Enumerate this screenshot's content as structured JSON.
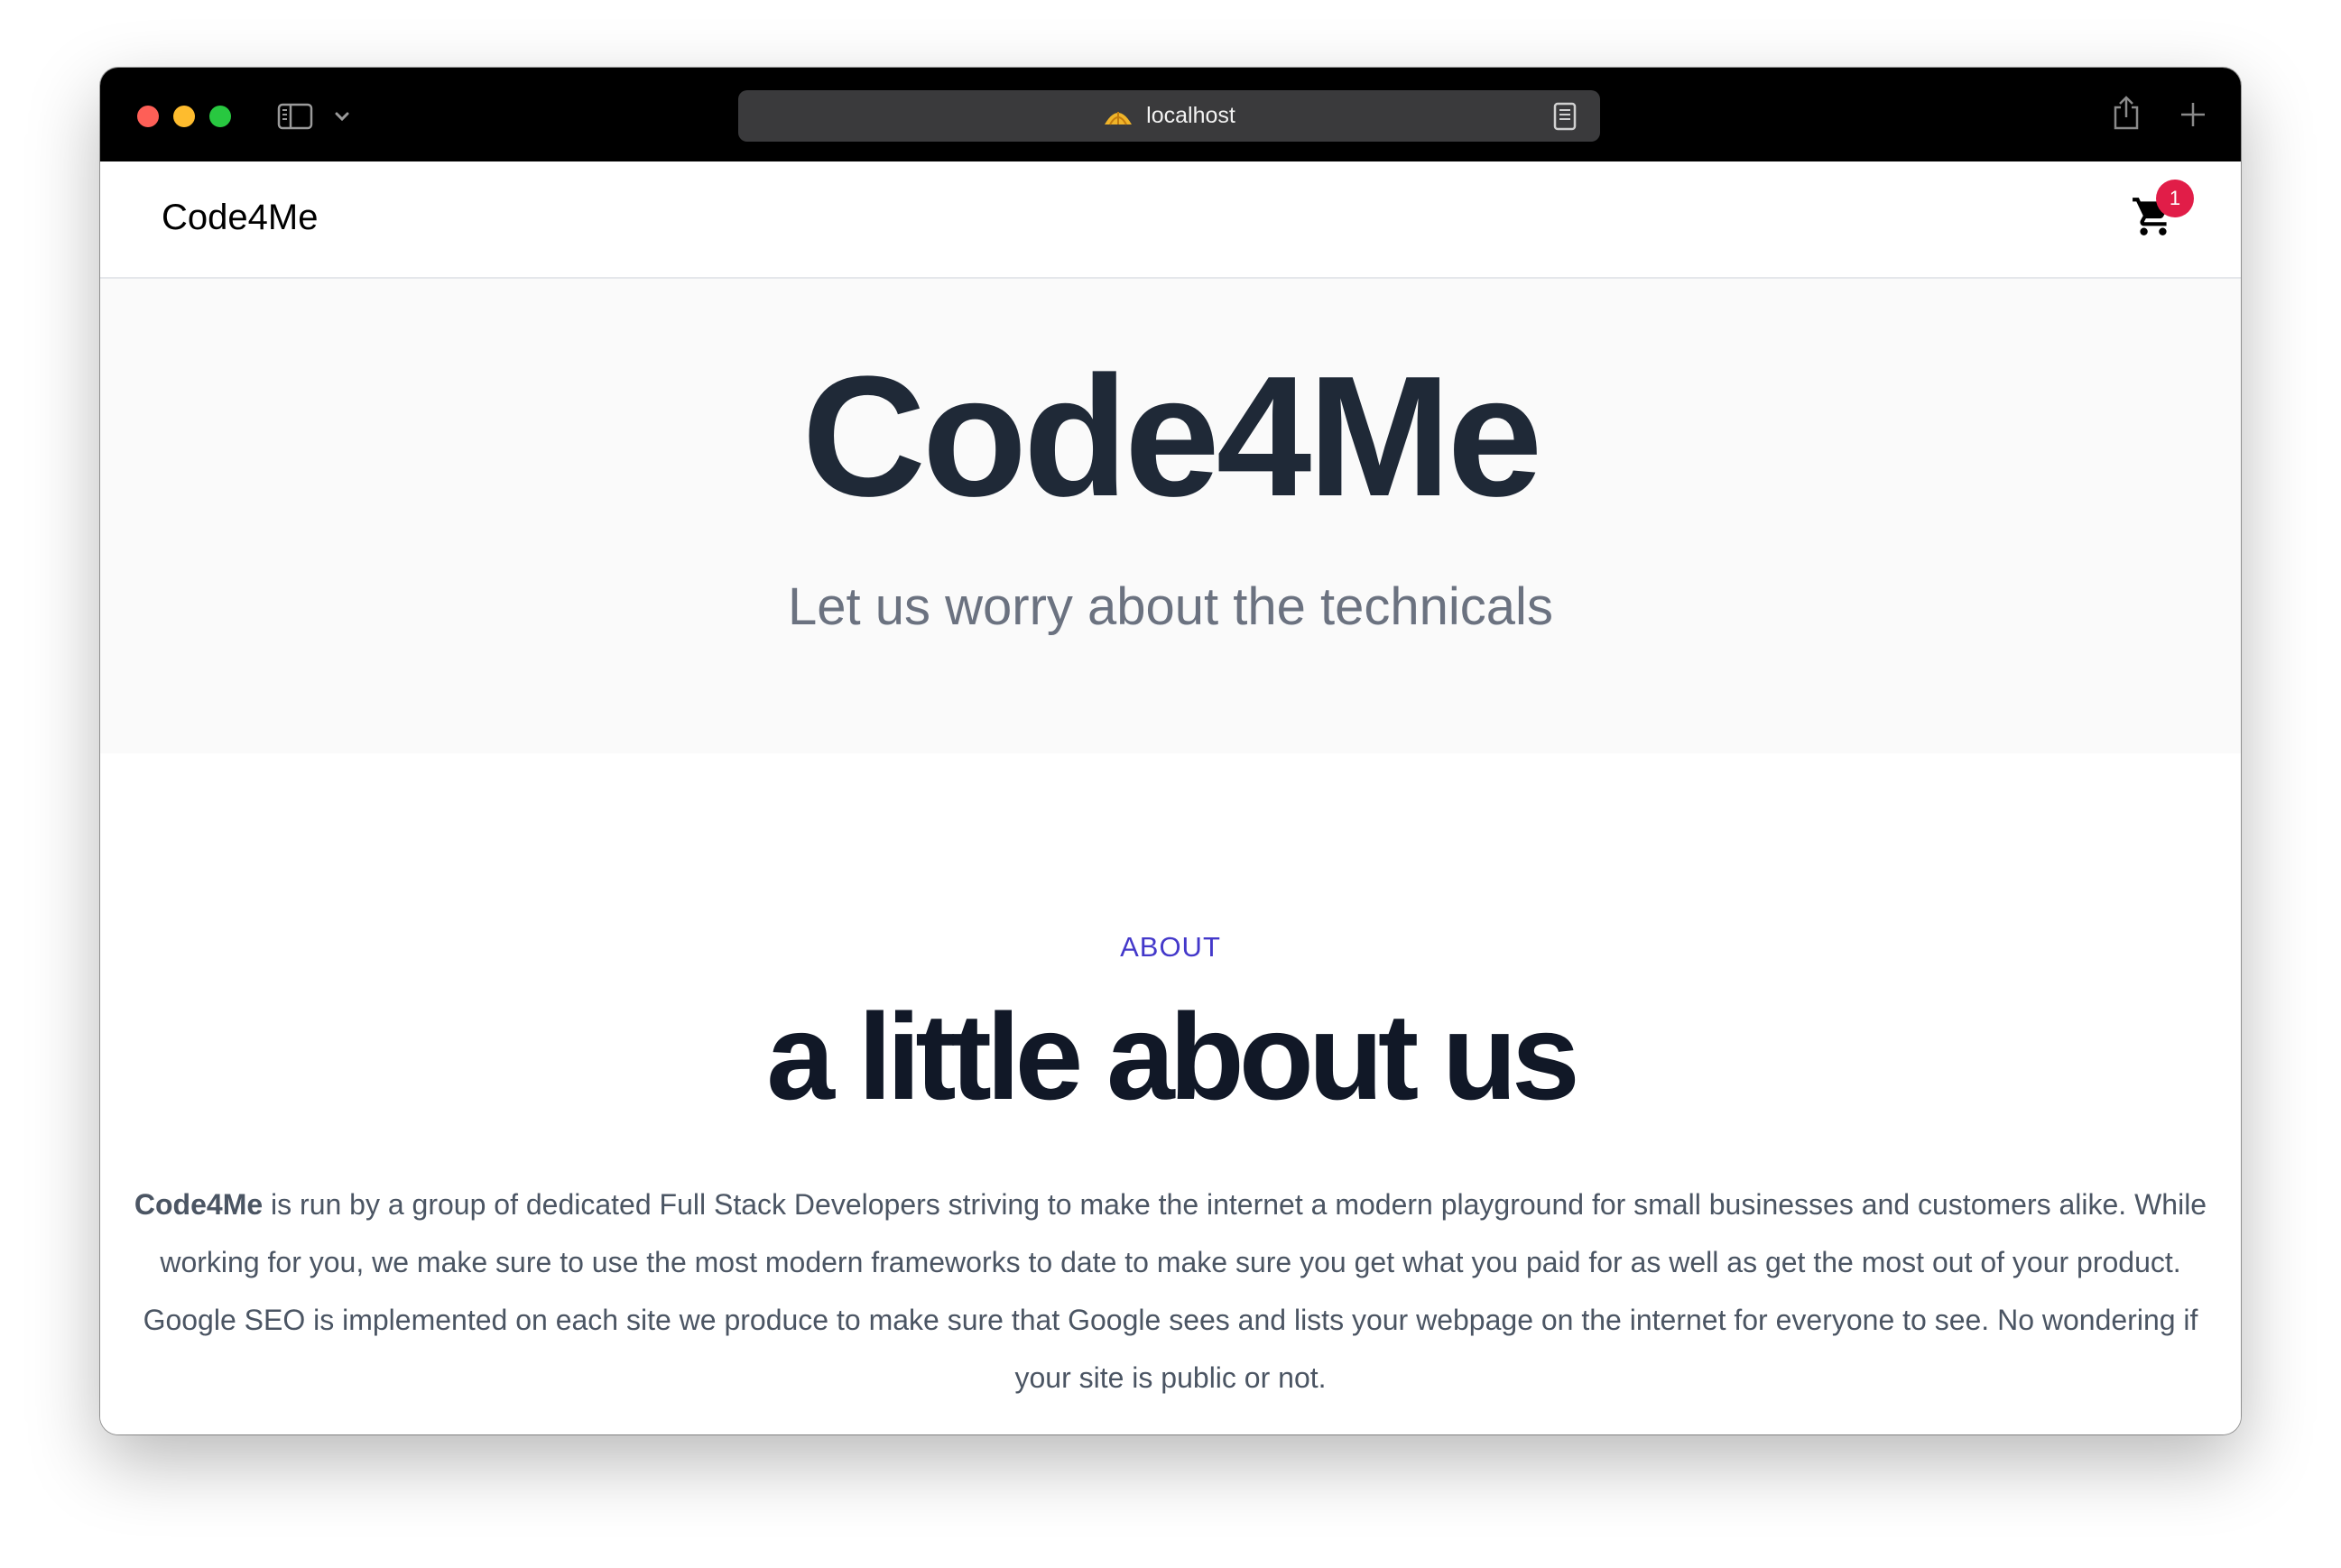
{
  "browser": {
    "url": "localhost"
  },
  "navbar": {
    "brand": "Code4Me",
    "cart_count": "1"
  },
  "hero": {
    "title": "Code4Me",
    "subtitle": "Let us worry about the technicals"
  },
  "about": {
    "kicker": "ABOUT",
    "title": "a little about us",
    "body_strong": "Code4Me",
    "body_rest": " is run by a group of dedicated Full Stack Developers striving to make the internet a modern playground for small businesses and customers alike. While working for you, we make sure to use the most modern frameworks to date to make sure you get what you paid for as well as get the most out of your product. Google SEO is implemented on each site we produce to make sure that Google sees and lists your webpage on the internet for everyone to see. No wondering if your site is public or not."
  },
  "colors": {
    "accent": "#4338ca",
    "badge": "#e11d48",
    "heading": "#1f2937",
    "muted": "#6b7280"
  },
  "icons": [
    "sidebar-icon",
    "chevron-down-icon",
    "site-favicon-icon",
    "reader-icon",
    "share-icon",
    "new-tab-icon",
    "cart-icon"
  ]
}
